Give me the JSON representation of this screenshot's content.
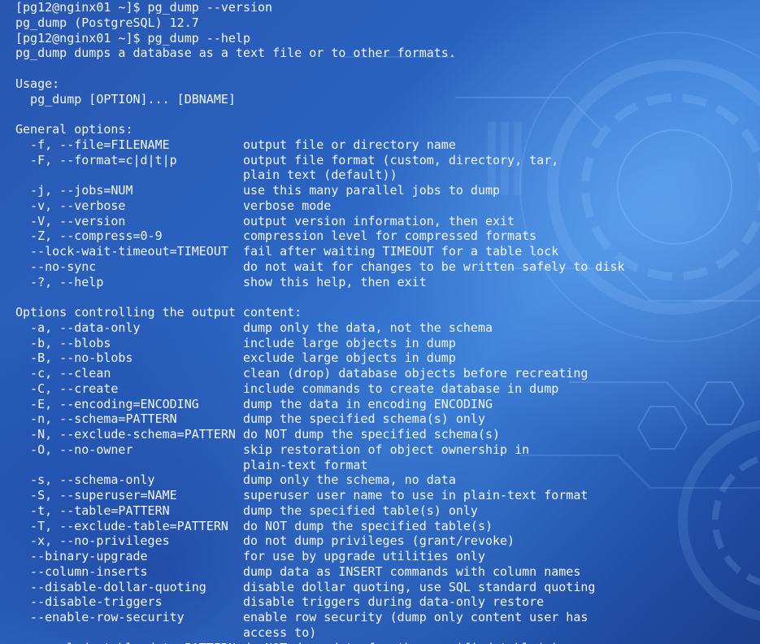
{
  "colors": {
    "background": "#2a62c0",
    "text": "#f2f5fa"
  },
  "terminal": {
    "lines": [
      "[pg12@nginx01 ~]$ pg_dump --version",
      "pg_dump (PostgreSQL) 12.7",
      "[pg12@nginx01 ~]$ pg_dump --help",
      "pg_dump dumps a database as a text file or to other formats.",
      "",
      "Usage:",
      "  pg_dump [OPTION]... [DBNAME]",
      "",
      "General options:",
      "  -f, --file=FILENAME          output file or directory name",
      "  -F, --format=c|d|t|p         output file format (custom, directory, tar,",
      "                               plain text (default))",
      "  -j, --jobs=NUM               use this many parallel jobs to dump",
      "  -v, --verbose                verbose mode",
      "  -V, --version                output version information, then exit",
      "  -Z, --compress=0-9           compression level for compressed formats",
      "  --lock-wait-timeout=TIMEOUT  fail after waiting TIMEOUT for a table lock",
      "  --no-sync                    do not wait for changes to be written safely to disk",
      "  -?, --help                   show this help, then exit",
      "",
      "Options controlling the output content:",
      "  -a, --data-only              dump only the data, not the schema",
      "  -b, --blobs                  include large objects in dump",
      "  -B, --no-blobs               exclude large objects in dump",
      "  -c, --clean                  clean (drop) database objects before recreating",
      "  -C, --create                 include commands to create database in dump",
      "  -E, --encoding=ENCODING      dump the data in encoding ENCODING",
      "  -n, --schema=PATTERN         dump the specified schema(s) only",
      "  -N, --exclude-schema=PATTERN do NOT dump the specified schema(s)",
      "  -O, --no-owner               skip restoration of object ownership in",
      "                               plain-text format",
      "  -s, --schema-only            dump only the schema, no data",
      "  -S, --superuser=NAME         superuser user name to use in plain-text format",
      "  -t, --table=PATTERN          dump the specified table(s) only",
      "  -T, --exclude-table=PATTERN  do NOT dump the specified table(s)",
      "  -x, --no-privileges          do not dump privileges (grant/revoke)",
      "  --binary-upgrade             for use by upgrade utilities only",
      "  --column-inserts             dump data as INSERT commands with column names",
      "  --disable-dollar-quoting     disable dollar quoting, use SQL standard quoting",
      "  --disable-triggers           disable triggers during data-only restore",
      "  --enable-row-security        enable row security (dump only content user has",
      "                               access to)",
      "  --exclude-table-data=PATTERN do NOT dump data for the specified table(s)"
    ]
  }
}
